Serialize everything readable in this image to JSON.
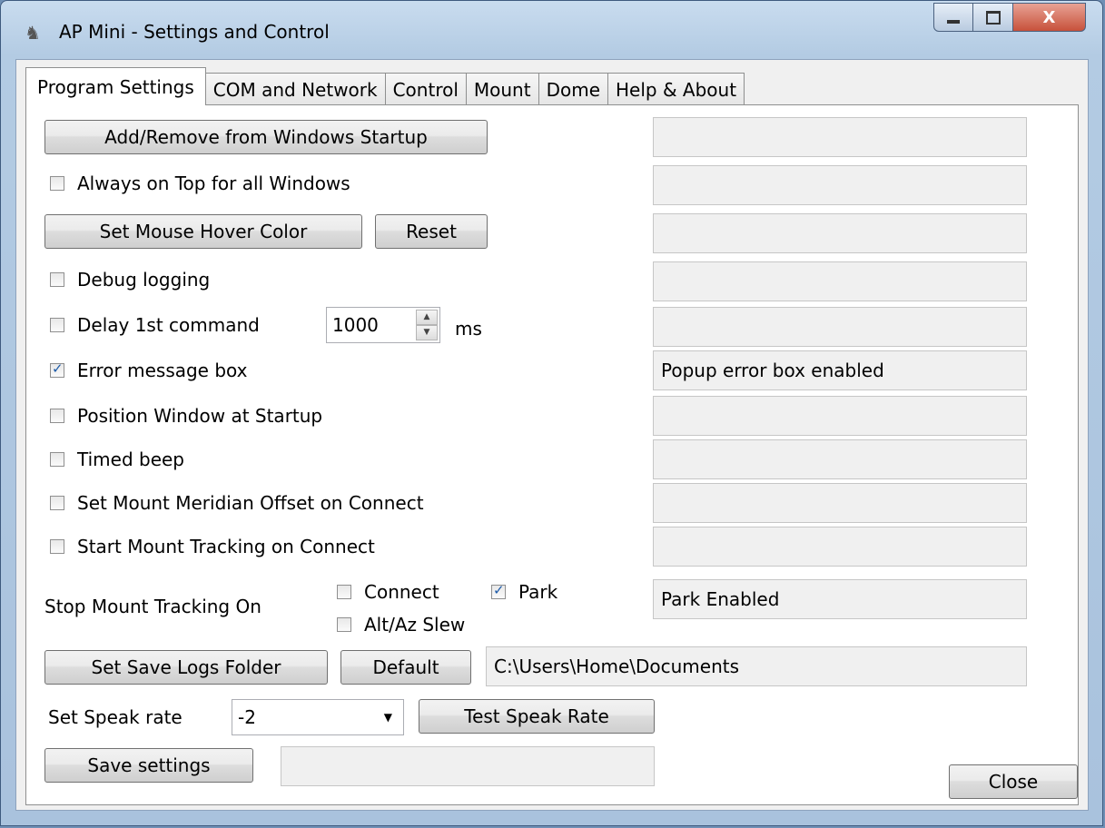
{
  "window": {
    "title": "AP Mini - Settings and Control"
  },
  "caption": {
    "minimize_icon": "minimize-icon",
    "maximize_icon": "maximize-icon",
    "close_icon": "close-icon",
    "close_glyph": "X"
  },
  "tabs": [
    {
      "label": "Program Settings",
      "active": true
    },
    {
      "label": "COM and Network"
    },
    {
      "label": "Control"
    },
    {
      "label": "Mount"
    },
    {
      "label": "Dome"
    },
    {
      "label": "Help & About"
    }
  ],
  "settings": {
    "startup_button": "Add/Remove from Windows Startup",
    "always_on_top": {
      "label": "Always on Top for all Windows",
      "checked": false
    },
    "hover_color_button": "Set Mouse Hover Color",
    "reset_button": "Reset",
    "debug_logging": {
      "label": "Debug logging",
      "checked": false
    },
    "delay_first": {
      "label": "Delay 1st command",
      "checked": false,
      "value": "1000",
      "unit": "ms"
    },
    "error_box": {
      "label": "Error message box",
      "checked": true
    },
    "position_window": {
      "label": "Position Window at Startup",
      "checked": false
    },
    "timed_beep": {
      "label": "Timed beep",
      "checked": false
    },
    "meridian_offset": {
      "label": "Set Mount Meridian Offset on Connect",
      "checked": false
    },
    "start_tracking": {
      "label": "Start Mount Tracking on Connect",
      "checked": false
    },
    "stop_tracking_label": "Stop Mount Tracking On",
    "stop_connect": {
      "label": "Connect",
      "checked": false
    },
    "stop_park": {
      "label": "Park",
      "checked": true
    },
    "stop_altaz": {
      "label": "Alt/Az Slew",
      "checked": false
    },
    "logs_folder_button": "Set Save Logs Folder",
    "default_button": "Default",
    "speak_rate_label": "Set Speak rate",
    "speak_rate_value": "-2",
    "test_speak_button": "Test Speak Rate",
    "save_button": "Save settings",
    "close_button": "Close"
  },
  "status": {
    "startup": "",
    "always_on_top": "",
    "hover_color": "",
    "debug": "",
    "delay": "",
    "error_box": "Popup error box enabled",
    "position": "",
    "beep": "",
    "meridian": "",
    "start_tracking": "",
    "stop_tracking": "Park Enabled",
    "logs_folder": "C:\\Users\\Home\\Documents",
    "save": ""
  }
}
